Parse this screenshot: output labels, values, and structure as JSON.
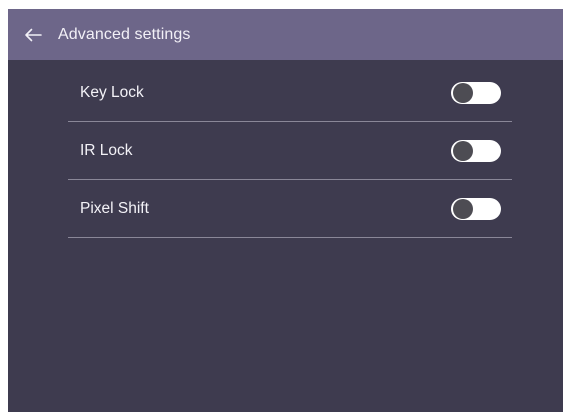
{
  "header": {
    "back_icon": "arrow-left-icon",
    "title": "Advanced settings"
  },
  "settings": [
    {
      "label": "Key Lock",
      "enabled": false
    },
    {
      "label": "IR Lock",
      "enabled": false
    },
    {
      "label": "Pixel Shift",
      "enabled": false
    }
  ],
  "colors": {
    "header_bg": "#6d6689",
    "panel_bg": "#3e3b4f",
    "toggle_track": "#ffffff",
    "toggle_knob": "#4d4c53"
  }
}
